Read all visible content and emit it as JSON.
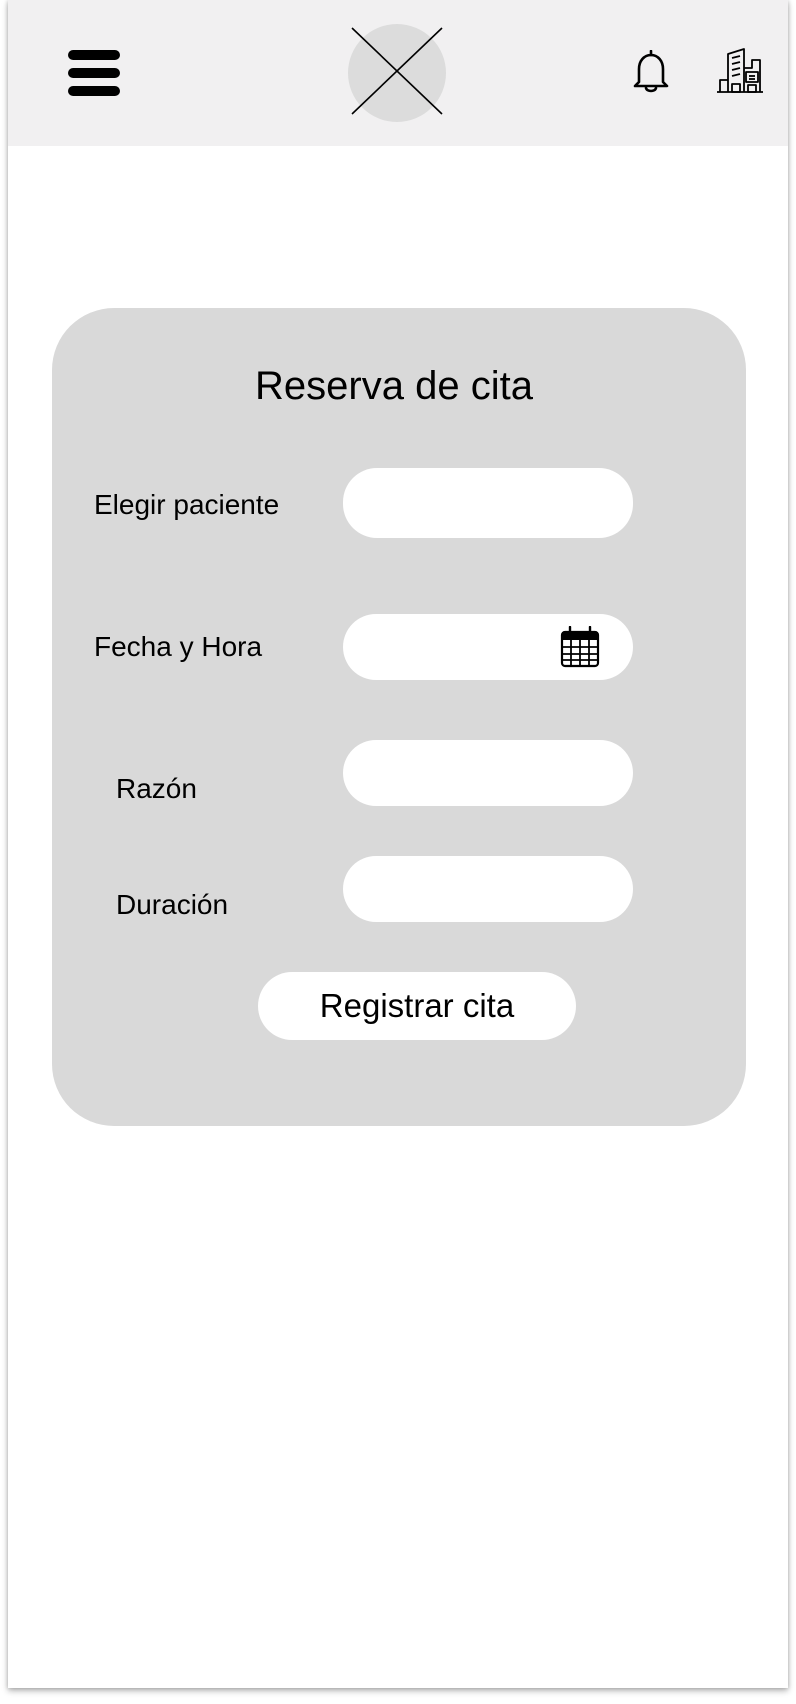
{
  "header": {
    "menu_icon": "hamburger-menu-icon",
    "logo_icon": "logo-placeholder-icon",
    "notifications_icon": "bell-icon",
    "organization_icon": "hospital-building-icon",
    "background_color": "#f1f0f1"
  },
  "form": {
    "title": "Reserva de cita",
    "background_color": "#d9d9d9",
    "fields": {
      "patient": {
        "label": "Elegir paciente",
        "value": ""
      },
      "datetime": {
        "label": "Fecha y Hora",
        "value": "",
        "icon": "calendar-icon"
      },
      "reason": {
        "label": "Razón",
        "value": ""
      },
      "duration": {
        "label": "Duración",
        "value": ""
      }
    },
    "submit_label": "Registrar cita"
  }
}
